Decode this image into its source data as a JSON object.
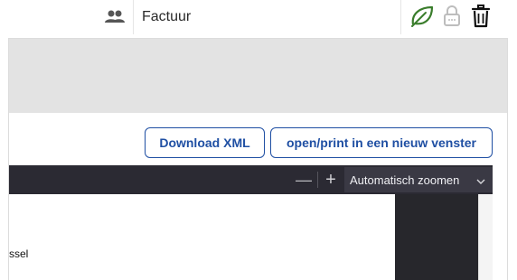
{
  "header": {
    "doc_type": "Factuur",
    "icons": [
      "people-icon",
      "leaf-icon",
      "lock-icon",
      "trash-icon"
    ],
    "leaf_color": "#3a7d2c"
  },
  "actions": {
    "download_xml": "Download XML",
    "open_print": "open/print in een nieuw venster",
    "accent": "#1f4fa3"
  },
  "viewer": {
    "zoom_out": "—",
    "zoom_in": "+",
    "zoom_value": "Automatisch zoomen",
    "visible_text": "ssel"
  }
}
